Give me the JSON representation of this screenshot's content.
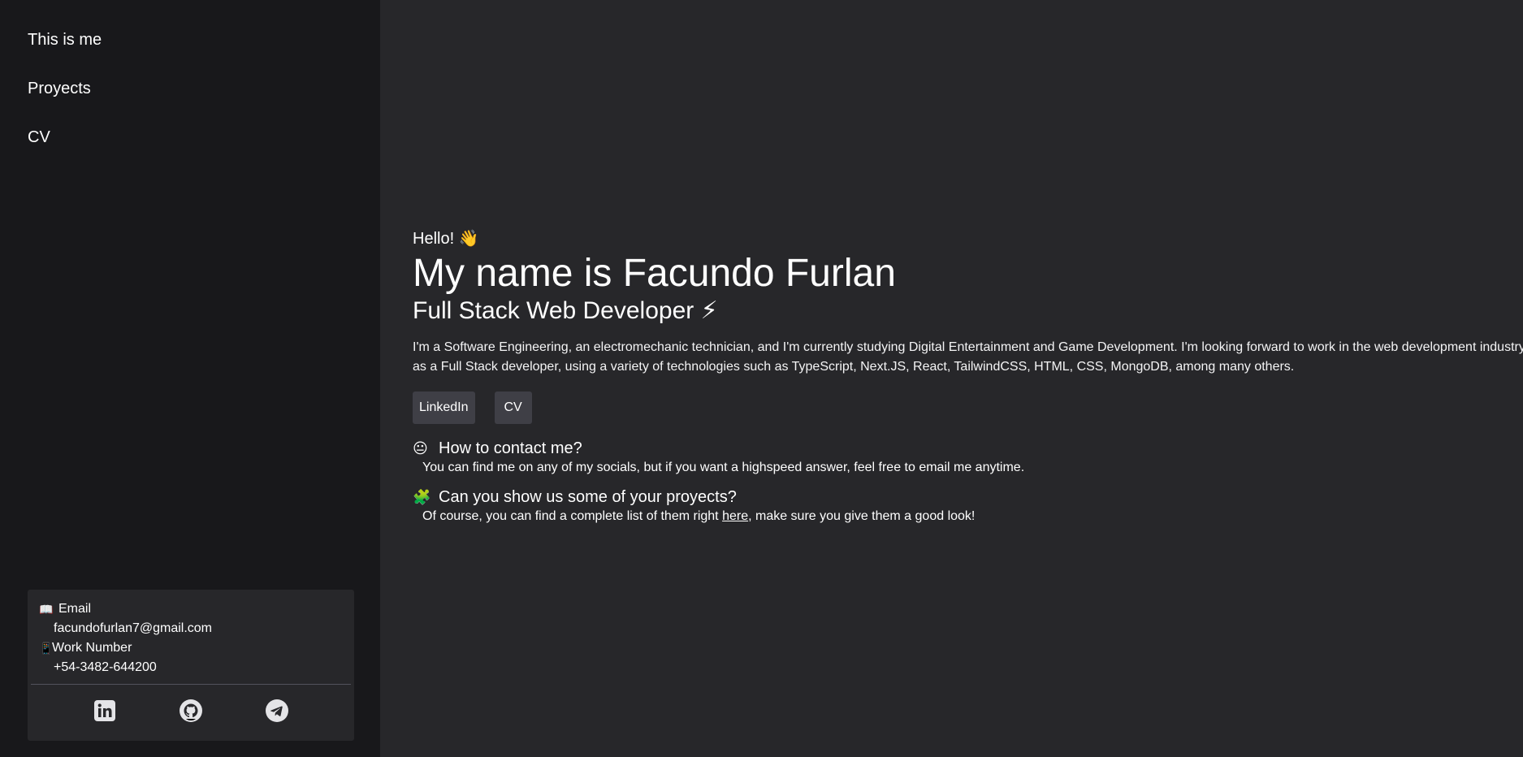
{
  "sidebar": {
    "nav": [
      {
        "label": "This is me"
      },
      {
        "label": "Proyects"
      },
      {
        "label": "CV"
      }
    ],
    "contact": {
      "email_emoji": "📖",
      "email_label": "Email",
      "email_value": "facundofurlan7@gmail.com",
      "phone_emoji": "📱",
      "phone_label": "Work Number",
      "phone_value": "+54-3482-644200"
    },
    "socials": [
      {
        "icon": "linkedin-icon"
      },
      {
        "icon": "github-icon"
      },
      {
        "icon": "telegram-icon"
      }
    ]
  },
  "hero": {
    "greeting": "Hello! 👋",
    "name": "My name is Facundo Furlan",
    "role": "Full Stack Web Developer ⚡",
    "bio": "I'm a Software Engineering, an electromechanic technician, and I'm currently studying Digital Entertainment and Game Development. I'm looking forward to work in the web development industry as a Full Stack developer, using a variety of technologies such as TypeScript, Next.JS, React, TailwindCSS, HTML, CSS, MongoDB, among many others.",
    "buttons": {
      "linkedin": "LinkedIn",
      "cv": "CV"
    }
  },
  "faq": [
    {
      "emoji": "😐",
      "question": "How to contact me?",
      "answer": "You can find me on any of my socials, but if you want a highspeed answer, feel free to email me anytime."
    },
    {
      "emoji": "🧩",
      "question": "Can you show us some of your proyects?",
      "answer_before": "Of course, you can find a complete list of them right ",
      "answer_link": "here",
      "answer_after": ", make sure you give them a good look!"
    }
  ],
  "colors": {
    "sidebar_bg": "#18181b",
    "main_bg": "#27272a",
    "button_bg": "#3f3f46",
    "text": "#ffffff"
  }
}
